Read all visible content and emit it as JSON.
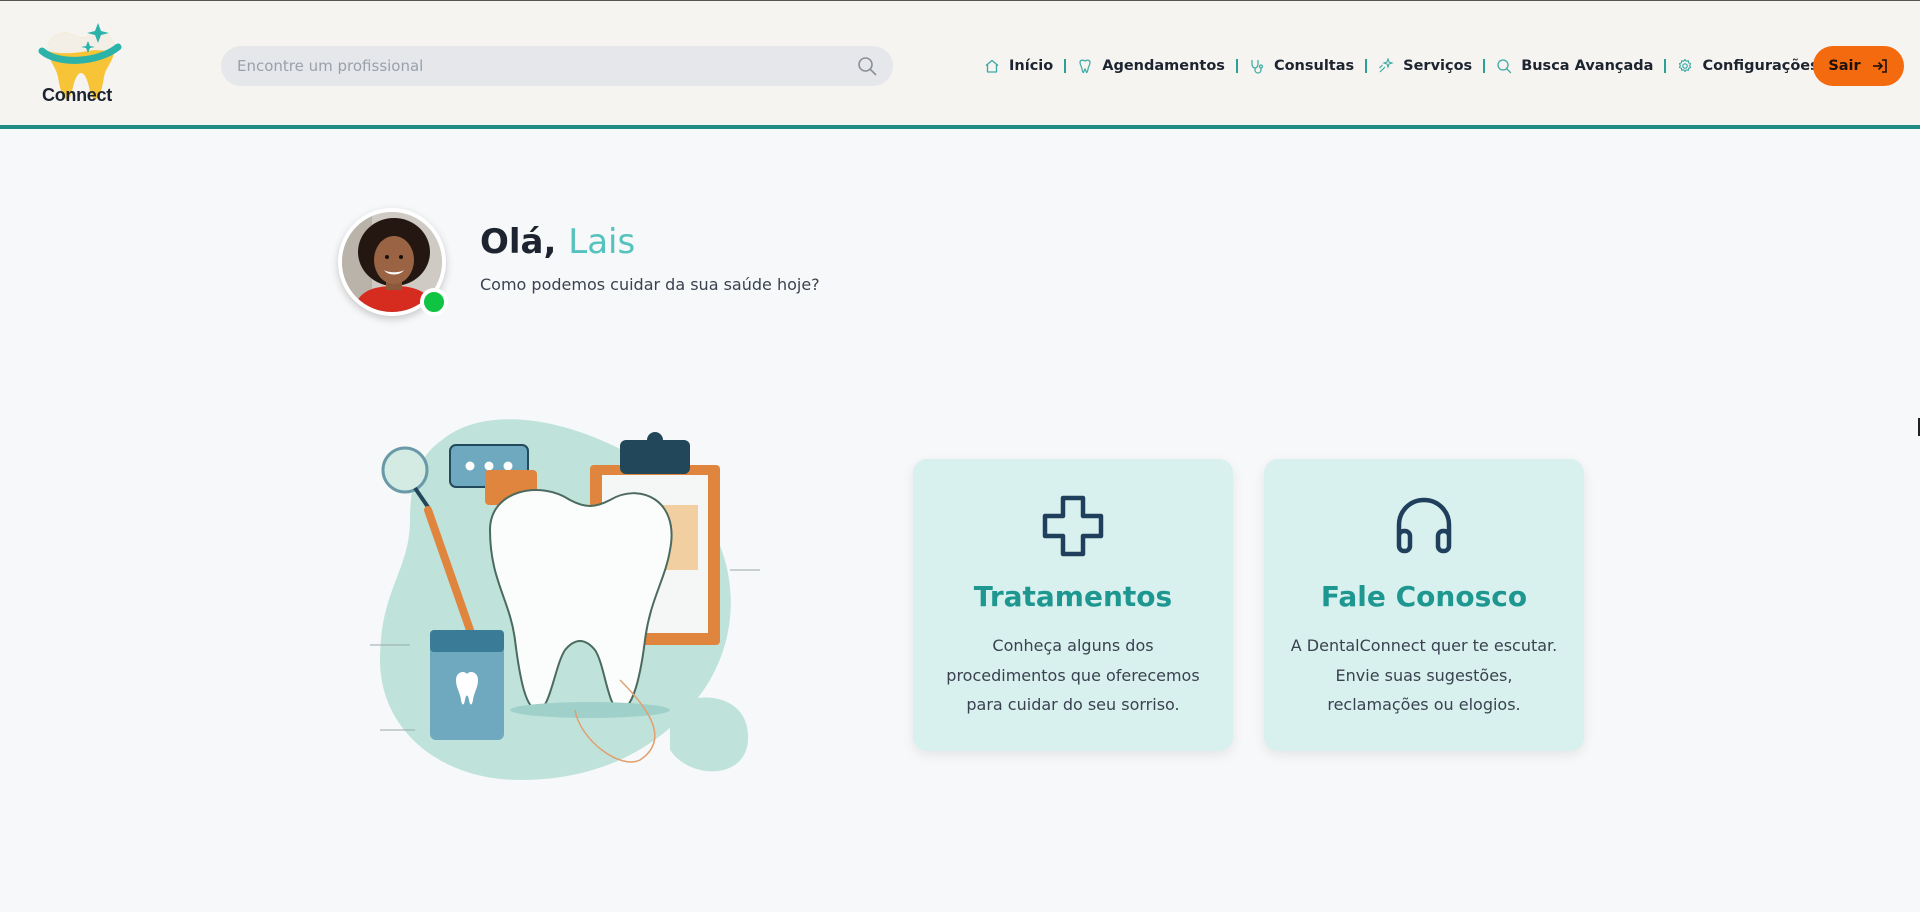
{
  "app": {
    "logo_text": "Connect"
  },
  "header": {
    "search": {
      "placeholder": "Encontre um profissional",
      "value": ""
    },
    "nav": [
      {
        "label": "Início",
        "icon": "home-icon"
      },
      {
        "label": "Agendamentos",
        "icon": "tooth-icon"
      },
      {
        "label": "Consultas",
        "icon": "stethoscope-icon"
      },
      {
        "label": "Serviços",
        "icon": "sparkle-icon"
      },
      {
        "label": "Busca Avançada",
        "icon": "search-icon"
      },
      {
        "label": "Configurações",
        "icon": "gear-icon"
      }
    ],
    "logout_label": "Sair"
  },
  "greeting": {
    "hello": "Olá,",
    "name": "Lais",
    "subtitle": "Como podemos cuidar da sua saúde hoje?"
  },
  "cards": [
    {
      "title": "Tratamentos",
      "icon": "plus-icon",
      "description": "Conheça alguns dos procedimentos que oferecemos para cuidar do seu sorriso."
    },
    {
      "title": "Fale Conosco",
      "icon": "headphones-icon",
      "description": "A DentalConnect quer te escutar. Envie suas sugestões, reclamações ou elogios."
    }
  ],
  "colors": {
    "accent": "#1e8c84",
    "name_highlight": "#55c2bd",
    "logout": "#f46a0f",
    "card_bg": "#d8f0ee",
    "online": "#10c443"
  }
}
